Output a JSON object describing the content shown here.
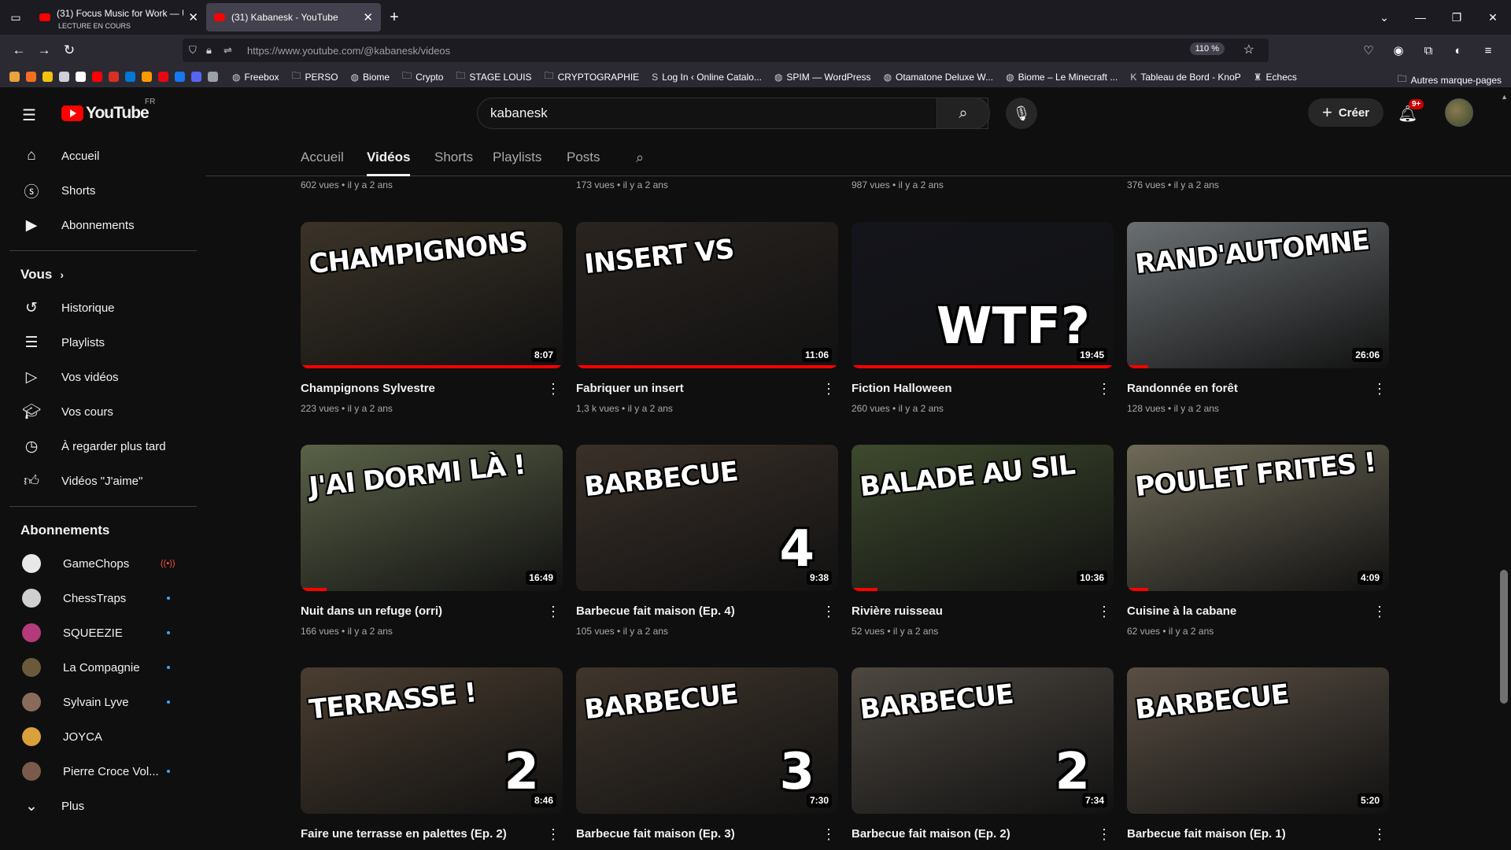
{
  "browser": {
    "tabs": [
      {
        "title": "(31) Focus Music for Work — U",
        "subtitle": "LECTURE EN COURS",
        "active": false
      },
      {
        "title": "(31) Kabanesk - YouTube",
        "subtitle": "",
        "active": true
      }
    ],
    "url": "https://www.youtube.com/@kabanesk/videos",
    "zoom": "110 %",
    "bookmarks": [
      {
        "label": "Freebox",
        "icon": "globe-icon"
      },
      {
        "label": "PERSO",
        "icon": "folder-icon"
      },
      {
        "label": "Biome",
        "icon": "globe-icon"
      },
      {
        "label": "Crypto",
        "icon": "folder-icon"
      },
      {
        "label": "STAGE LOUIS",
        "icon": "folder-icon"
      },
      {
        "label": "CRYPTOGRAPHIE",
        "icon": "folder-icon"
      },
      {
        "label": "Log In ‹ Online Catalo...",
        "icon": "s-icon"
      },
      {
        "label": "SPIM — WordPress",
        "icon": "globe-icon"
      },
      {
        "label": "Otamatone Deluxe W...",
        "icon": "globe-icon"
      },
      {
        "label": "Biome – Le Minecraft ...",
        "icon": "globe-icon"
      },
      {
        "label": "Tableau de Bord - KnoP",
        "icon": "k-icon"
      },
      {
        "label": "Echecs",
        "icon": "chess-icon"
      }
    ],
    "other_bookmarks": "Autres marque-pages"
  },
  "yt": {
    "logo_text": "YouTube",
    "country": "FR",
    "search_query": "kabanesk",
    "create_label": "Créer",
    "notif_badge": "9+",
    "sidebar": {
      "main": [
        {
          "label": "Accueil",
          "icon": "home-icon"
        },
        {
          "label": "Shorts",
          "icon": "shorts-icon"
        },
        {
          "label": "Abonnements",
          "icon": "subscriptions-icon"
        }
      ],
      "you_header": "Vous",
      "you": [
        {
          "label": "Historique",
          "icon": "history-icon"
        },
        {
          "label": "Playlists",
          "icon": "playlists-icon"
        },
        {
          "label": "Vos vidéos",
          "icon": "your-videos-icon"
        },
        {
          "label": "Vos cours",
          "icon": "courses-icon"
        },
        {
          "label": "À regarder plus tard",
          "icon": "watch-later-icon"
        },
        {
          "label": "Vidéos \"J'aime\"",
          "icon": "liked-icon"
        }
      ],
      "subs_header": "Abonnements",
      "subs": [
        {
          "label": "GameChops",
          "status": "live"
        },
        {
          "label": "ChessTraps",
          "status": "new"
        },
        {
          "label": "SQUEEZIE",
          "status": "new"
        },
        {
          "label": "La Compagnie",
          "status": "new"
        },
        {
          "label": "Sylvain Lyve",
          "status": "new"
        },
        {
          "label": "JOYCA",
          "status": ""
        },
        {
          "label": "Pierre Croce Vol...",
          "status": "new"
        }
      ],
      "more_label": "Plus"
    },
    "channel_tabs": [
      "Accueil",
      "Vidéos",
      "Shorts",
      "Playlists",
      "Posts"
    ],
    "active_tab": "Vidéos",
    "top_meta": [
      "602 vues • il y a 2 ans",
      "173 vues • il y a 2 ans",
      "987 vues • il y a 2 ans",
      "376 vues • il y a 2 ans"
    ],
    "videos": [
      {
        "title": "Champignons Sylvestre",
        "meta": "223 vues • il y a 2 ans",
        "duration": "8:07",
        "overlay": "CHAMPIGNONS",
        "big": "",
        "progress": 1.0
      },
      {
        "title": "Fabriquer un insert",
        "meta": "1,3 k vues • il y a 2 ans",
        "duration": "11:06",
        "overlay": "INSERT VS",
        "big": "",
        "progress": 1.0
      },
      {
        "title": "Fiction Halloween",
        "meta": "260 vues • il y a 2 ans",
        "duration": "19:45",
        "overlay": "",
        "big": "WTF?",
        "progress": 1.0
      },
      {
        "title": "Randonnée en forêt",
        "meta": "128 vues • il y a 2 ans",
        "duration": "26:06",
        "overlay": "RAND'AUTOMNE",
        "big": "",
        "progress": 0.08
      },
      {
        "title": "Nuit dans un refuge (orri)",
        "meta": "166 vues • il y a 2 ans",
        "duration": "16:49",
        "overlay": "J'AI DORMI LÀ !",
        "big": "",
        "progress": 0.1
      },
      {
        "title": "Barbecue fait maison (Ep. 4)",
        "meta": "105 vues • il y a 2 ans",
        "duration": "9:38",
        "overlay": "BARBECUE",
        "big": "4",
        "progress": 0.0
      },
      {
        "title": "Rivière ruisseau",
        "meta": "52 vues • il y a 2 ans",
        "duration": "10:36",
        "overlay": "BALADE AU SIL",
        "big": "",
        "progress": 0.1
      },
      {
        "title": "Cuisine à la cabane",
        "meta": "62 vues • il y a 2 ans",
        "duration": "4:09",
        "overlay": "POULET FRITES !",
        "big": "",
        "progress": 0.08
      },
      {
        "title": "Faire une terrasse en palettes (Ep. 2)",
        "meta": "",
        "duration": "8:46",
        "overlay": "TERRASSE !",
        "big": "2",
        "progress": 0.0
      },
      {
        "title": "Barbecue fait maison (Ep. 3)",
        "meta": "",
        "duration": "7:30",
        "overlay": "BARBECUE",
        "big": "3",
        "progress": 0.0
      },
      {
        "title": "Barbecue fait maison (Ep. 2)",
        "meta": "",
        "duration": "7:34",
        "overlay": "BARBECUE",
        "big": "2",
        "progress": 0.0
      },
      {
        "title": "Barbecue fait maison (Ep. 1)",
        "meta": "",
        "duration": "5:20",
        "overlay": "BARBECUE",
        "big": "",
        "progress": 0.0
      }
    ],
    "thumb_colors": [
      "#3b3328",
      "#2a2420",
      "#14151c",
      "#6a6f72",
      "#5a6248",
      "#3a3029",
      "#3e4a2e",
      "#6f6a58",
      "#4a3d30",
      "#3f352c",
      "#4d4740",
      "#5a4f44"
    ]
  }
}
